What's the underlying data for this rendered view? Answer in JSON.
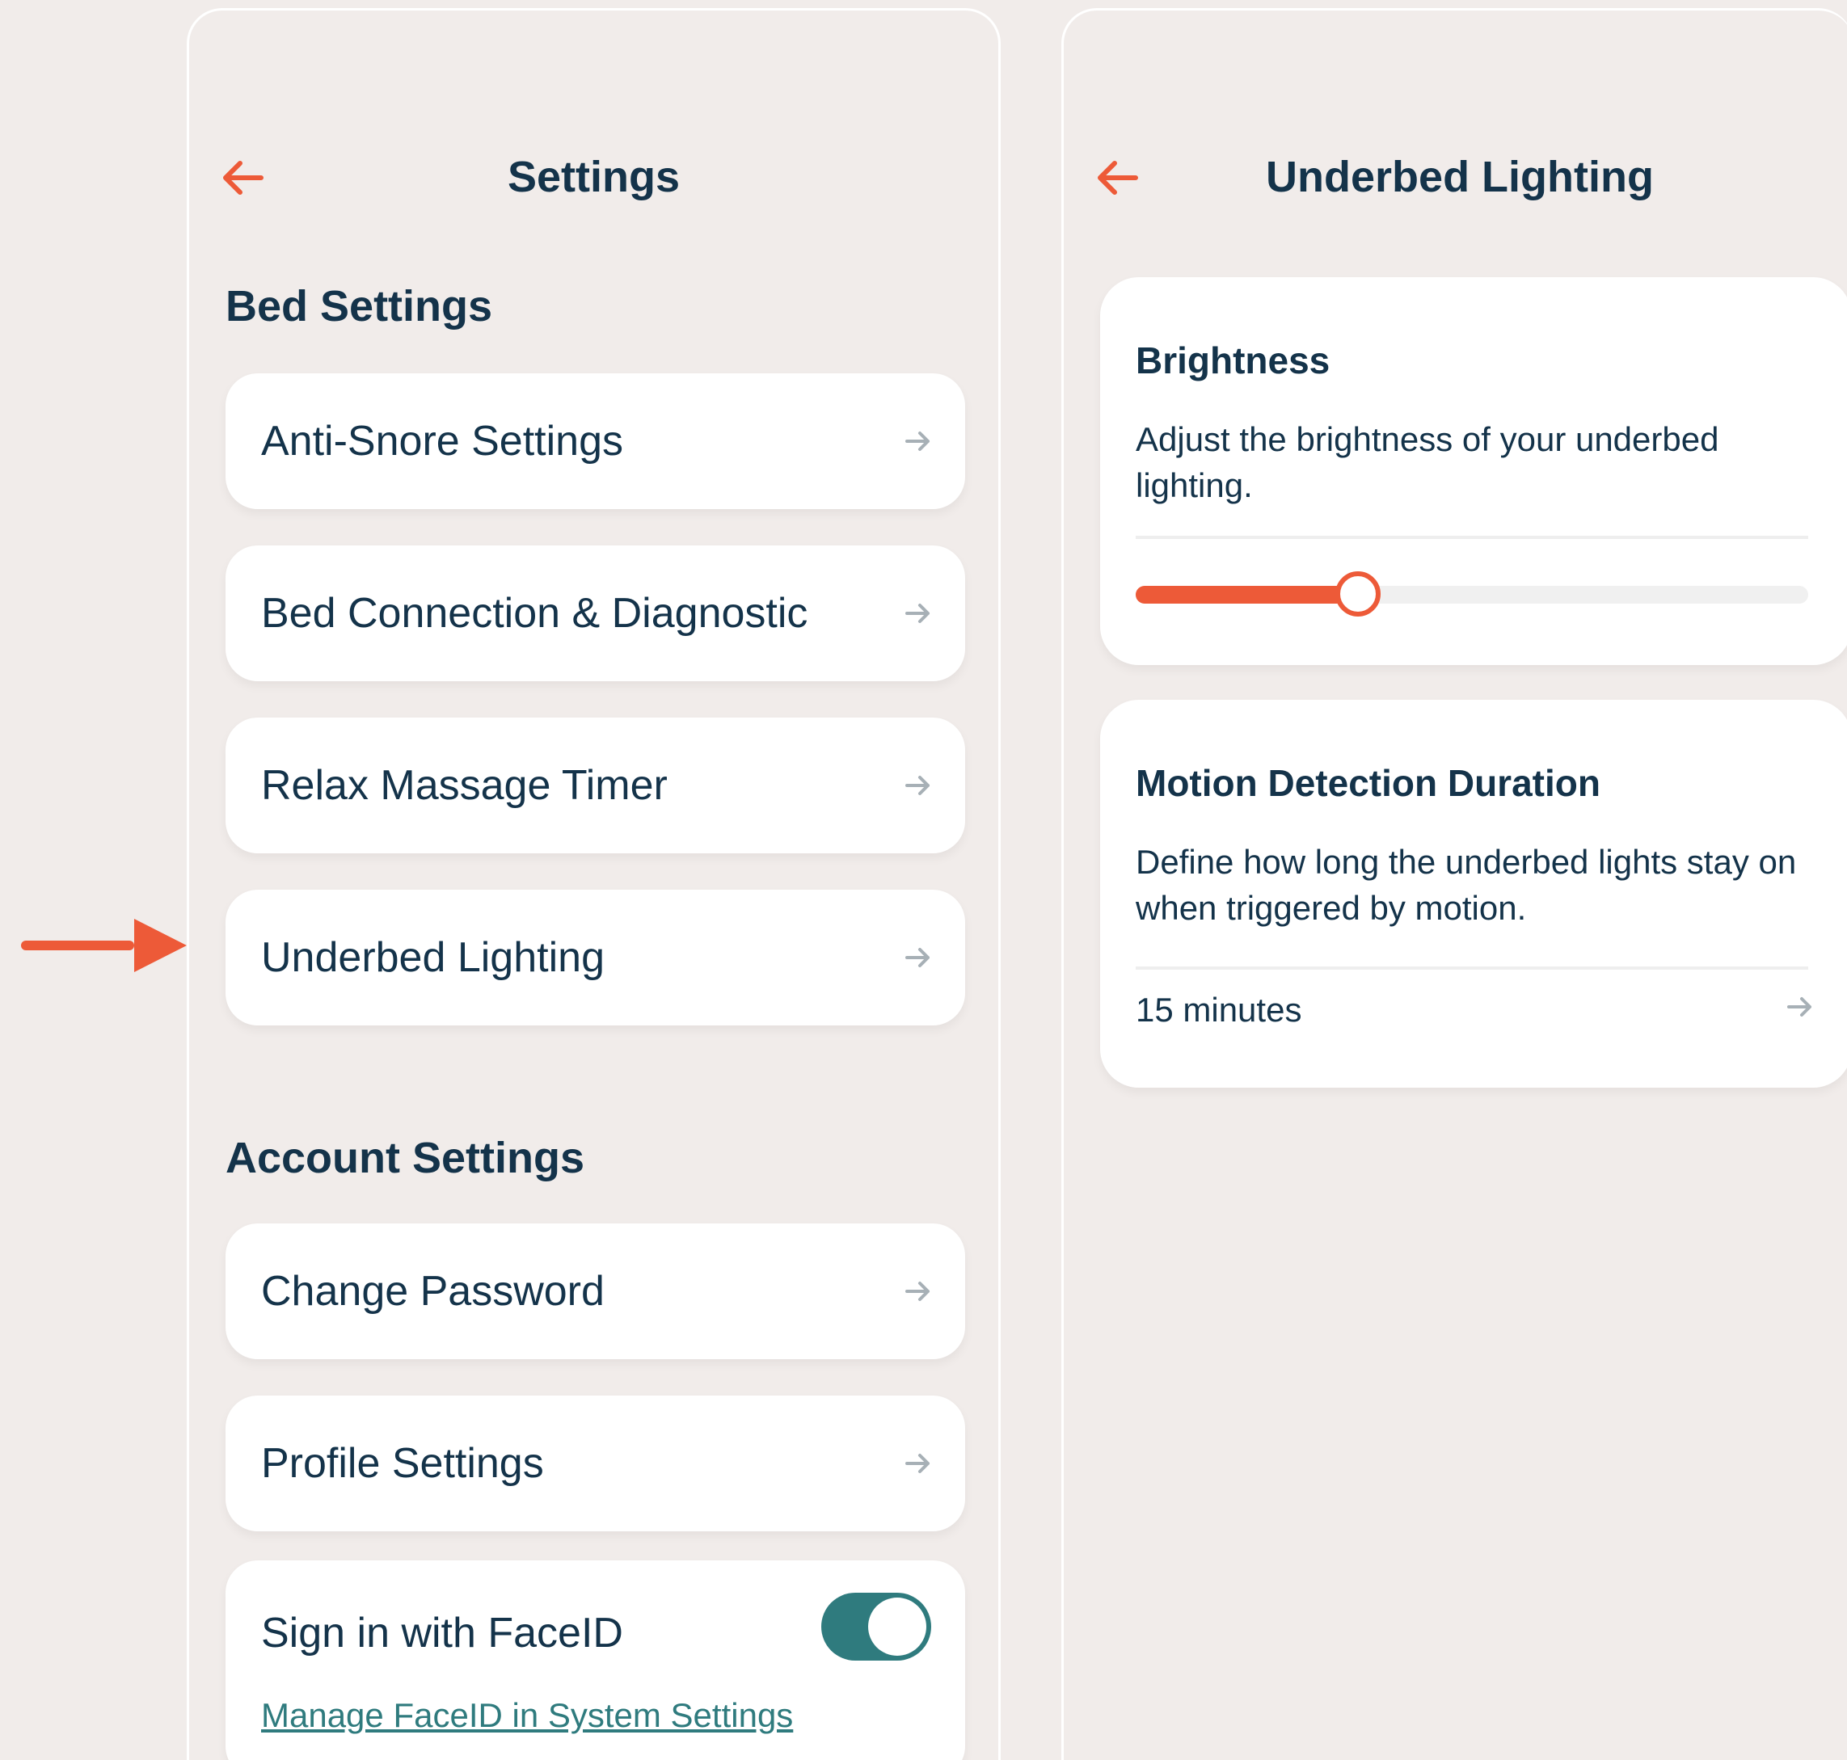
{
  "colors": {
    "accent": "#ed5a38",
    "text": "#14334a",
    "toggle_on": "#2f7b7e",
    "background": "#f1ecea",
    "card": "#ffffff",
    "row_arrow": "#a7b0b6"
  },
  "settings_screen": {
    "back_icon": "arrow-left-icon",
    "title": "Settings",
    "bed_settings": {
      "heading": "Bed Settings",
      "items": [
        {
          "label": "Anti-Snore Settings"
        },
        {
          "label": "Bed Connection & Diagnostic"
        },
        {
          "label": "Relax Massage Timer"
        },
        {
          "label": "Underbed Lighting"
        }
      ]
    },
    "account_settings": {
      "heading": "Account Settings",
      "items": [
        {
          "label": "Change Password"
        },
        {
          "label": "Profile Settings"
        }
      ],
      "faceid": {
        "label": "Sign in with FaceID",
        "enabled": true,
        "link": "Manage FaceID in System Settings"
      }
    },
    "row_arrow_icon": "arrow-right-icon"
  },
  "annotation": {
    "pointer_icon": "pointer-arrow-icon",
    "points_to": "Underbed Lighting"
  },
  "lighting_screen": {
    "back_icon": "arrow-left-icon",
    "title": "Underbed Lighting",
    "brightness": {
      "title": "Brightness",
      "description": "Adjust the brightness of your underbed lighting.",
      "value_fraction": 0.33
    },
    "motion": {
      "title": "Motion Detection Duration",
      "description": "Define how long the underbed lights stay on when triggered by motion.",
      "value": "15 minutes"
    }
  }
}
